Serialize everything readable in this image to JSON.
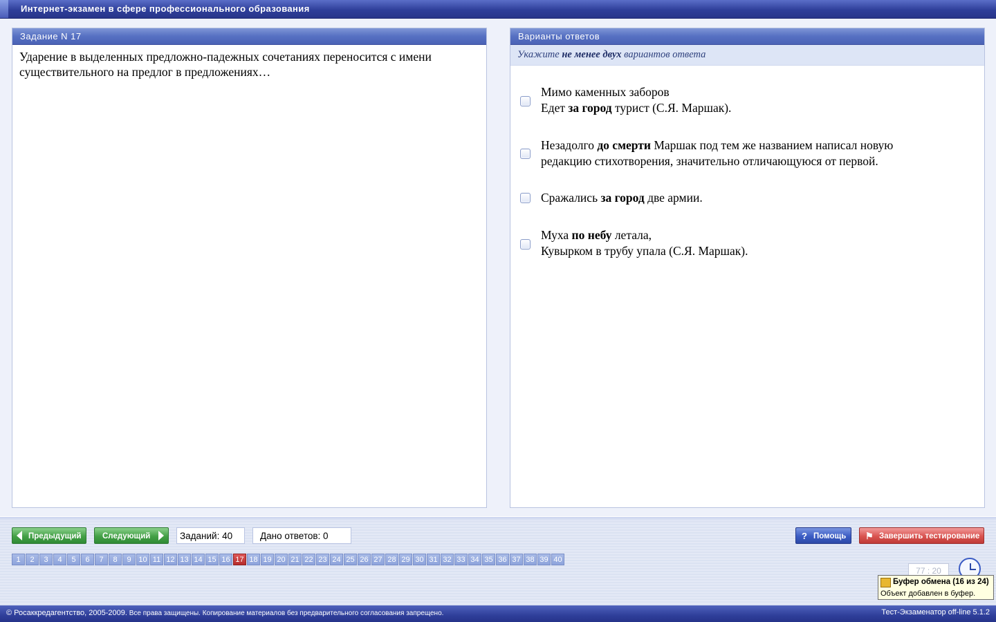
{
  "window": {
    "title": "Интернет-экзамен в сфере профессионального образования"
  },
  "question_panel": {
    "header": "Задание N 17",
    "text": "Ударение в выделенных предложно-падежных сочетаниях переносится с имени существительного на предлог в предложениях…"
  },
  "answers_panel": {
    "header": "Варианты ответов",
    "hint_pre": "Укажите",
    "hint_bold": "не менее двух",
    "hint_post": "вариантов ответа",
    "options": [
      {
        "l1_pre": "Мимо каменных заборов",
        "l2_pre": "Едет ",
        "l2_bold": "за город",
        "l2_post": " турист (С.Я. Маршак)."
      },
      {
        "l1_pre": "Незадолго ",
        "l1_bold": "до смерти",
        "l1_post": " Маршак под тем же названием написал новую",
        "l2_pre": "редакцию стихотворения, значительно отличающуюся от первой."
      },
      {
        "l1_pre": "Сражались ",
        "l1_bold": "за город",
        "l1_post": " две армии."
      },
      {
        "l1_pre": "Муха ",
        "l1_bold": "по небу",
        "l1_post": " летала,",
        "l2_pre": "Кувырком в трубу упала (С.Я. Маршак)."
      }
    ]
  },
  "nav": {
    "prev_label": "Предыдущий",
    "next_label": "Следующий",
    "total_label": "Заданий: 40",
    "answered_label": "Дано ответов: 0",
    "help_label": "Помощь",
    "finish_label": "Завершить тестирование",
    "current": 17,
    "pages": [
      "1",
      "2",
      "3",
      "4",
      "5",
      "6",
      "7",
      "8",
      "9",
      "10",
      "11",
      "12",
      "13",
      "14",
      "15",
      "16",
      "17",
      "18",
      "19",
      "20",
      "21",
      "22",
      "23",
      "24",
      "25",
      "26",
      "27",
      "28",
      "29",
      "30",
      "31",
      "32",
      "33",
      "34",
      "35",
      "36",
      "37",
      "38",
      "39",
      "40"
    ]
  },
  "timer": {
    "value": "77 : 20"
  },
  "tooltip": {
    "icon": "clipboard-icon",
    "title": "Буфер обмена (16 из 24)",
    "message": "Объект добавлен в буфер."
  },
  "footer": {
    "copyright_main": "© Росаккредагентство, 2005-2009.",
    "copyright_rest": " Все права защищены. Копирование материалов без предварительного согласования запрещено.",
    "app_version": "Тест-Экзаменатор off-line 5.1.2"
  },
  "colors": {
    "accent_blue": "#2f3f9a",
    "active_page": "#b52a2a",
    "next_button": "#43a046",
    "finish_button": "#d9534f"
  }
}
